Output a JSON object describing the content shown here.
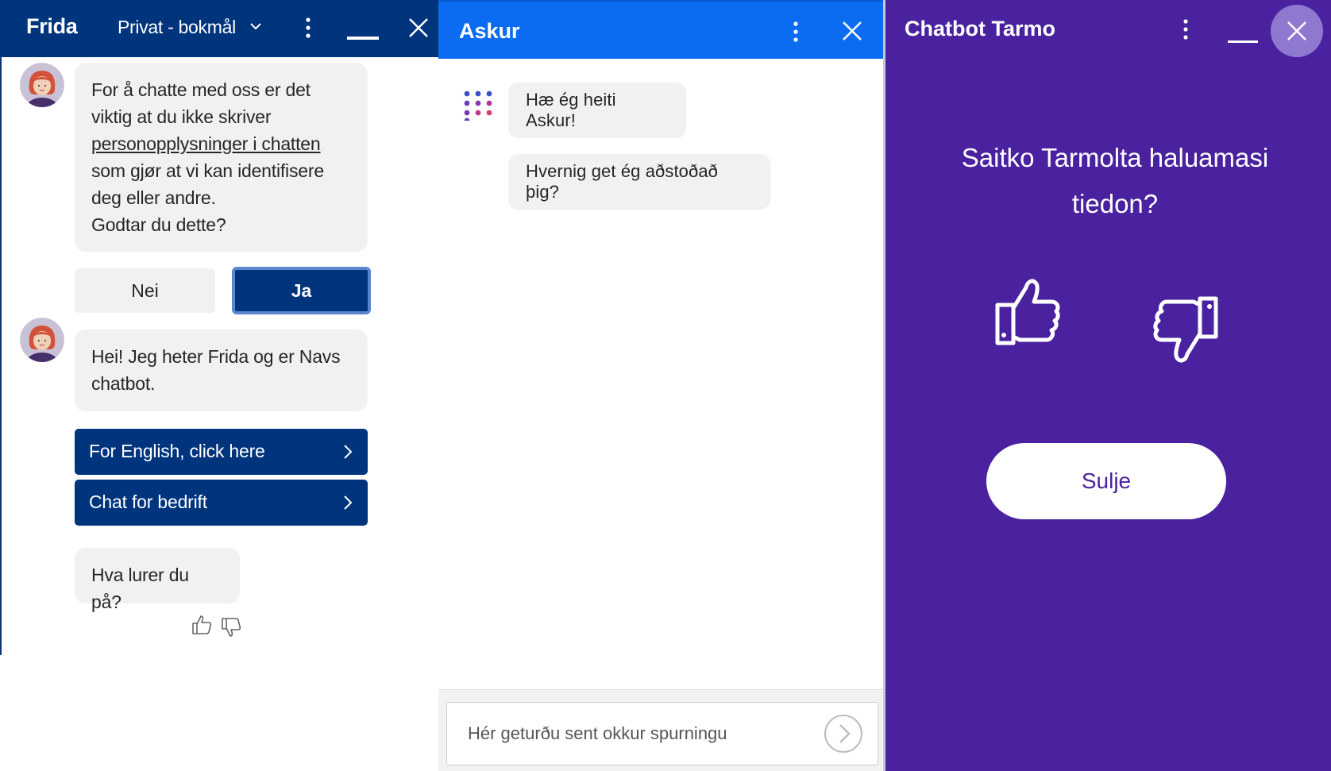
{
  "frida": {
    "title": "Frida",
    "language_select": "Privat - bokmål",
    "messages": {
      "privacy_part1": "For å chatte med oss er det viktig at du ikke skriver",
      "privacy_link": "personopplysninger i chatten",
      "privacy_part2": "som gjør at vi kan identifisere deg eller andre.",
      "privacy_question": "Godtar du dette?",
      "greeting": "Hei! Jeg heter Frida og er Navs chatbot.",
      "prompt": "Hva lurer du på?"
    },
    "buttons": {
      "no": "Nei",
      "yes": "Ja",
      "english": "For English, click here",
      "business": "Chat for bedrift"
    },
    "colors": {
      "header": "#00347d",
      "bubble": "#f1f1f1"
    }
  },
  "askur": {
    "title": "Askur",
    "messages": {
      "greeting": "Hæ ég heiti Askur!",
      "question": "Hvernig get ég aðstoðað þig?"
    },
    "input_placeholder": "Hér geturðu sent okkur spurningu",
    "colors": {
      "header": "#0b6cf2"
    }
  },
  "tarmo": {
    "title": "Chatbot Tarmo",
    "question": "Saitko Tarmolta haluamasi tiedon?",
    "close_label": "Sulje",
    "colors": {
      "background": "#4a22a0",
      "close_circle": "#8f78d0"
    }
  }
}
